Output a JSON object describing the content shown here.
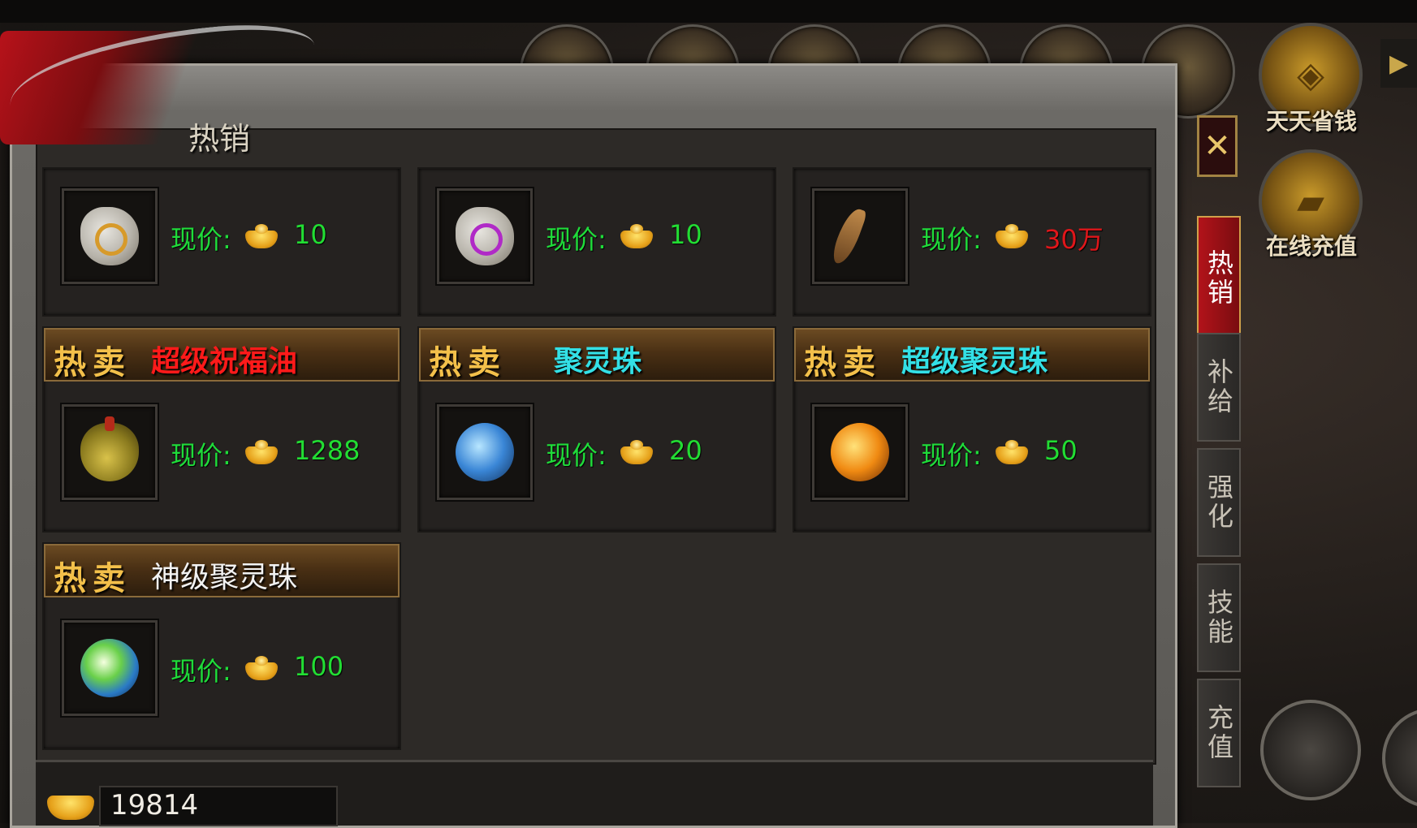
{
  "panel": {
    "title": "热销",
    "tab_label": "热销"
  },
  "items": [
    {
      "banner_hot": "",
      "name": "",
      "name_color": "",
      "price_label": "现价:",
      "price": "10",
      "price_color": "#22dd33",
      "item_icon": "scroll-gold-icon"
    },
    {
      "banner_hot": "",
      "name": "",
      "name_color": "",
      "price_label": "现价:",
      "price": "10",
      "price_color": "#22dd33",
      "item_icon": "scroll-purple-icon"
    },
    {
      "banner_hot": "",
      "name": "",
      "name_color": "",
      "price_label": "现价:",
      "price": "30万",
      "price_color": "#e0161a",
      "item_icon": "horn-icon"
    },
    {
      "banner_hot": "热卖",
      "name": "超级祝福油",
      "name_color": "#ff1a1a",
      "price_label": "现价:",
      "price": "1288",
      "price_color": "#22dd33",
      "item_icon": "oil-bottle-icon"
    },
    {
      "banner_hot": "热卖",
      "name": "聚灵珠",
      "name_color": "#33e0e6",
      "price_label": "现价:",
      "price": "20",
      "price_color": "#22dd33",
      "item_icon": "blue-orb-icon"
    },
    {
      "banner_hot": "热卖",
      "name": "超级聚灵珠",
      "name_color": "#33e0e6",
      "price_label": "现价:",
      "price": "50",
      "price_color": "#22dd33",
      "item_icon": "orange-orb-icon"
    },
    {
      "banner_hot": "热卖",
      "name": "神级聚灵珠",
      "name_color": "#f2f2f2",
      "price_label": "现价:",
      "price": "100",
      "price_color": "#22dd33",
      "item_icon": "rainbow-orb-icon"
    }
  ],
  "side_tabs": [
    {
      "label": "热销",
      "active": true
    },
    {
      "label": "补给",
      "active": false
    },
    {
      "label": "强化",
      "active": false
    },
    {
      "label": "技能",
      "active": false
    },
    {
      "label": "充值",
      "active": false
    }
  ],
  "right_menu": [
    {
      "label": "天天省钱",
      "icon": "coin-icon"
    },
    {
      "label": "在线充值",
      "icon": "gold-bars-icon"
    }
  ],
  "gold_balance": "19814",
  "colors": {
    "accent_gold": "#f3c04a",
    "price_green": "#22dd33",
    "price_red": "#e0161a",
    "name_cyan": "#33e0e6",
    "name_red": "#ff1a1a"
  }
}
